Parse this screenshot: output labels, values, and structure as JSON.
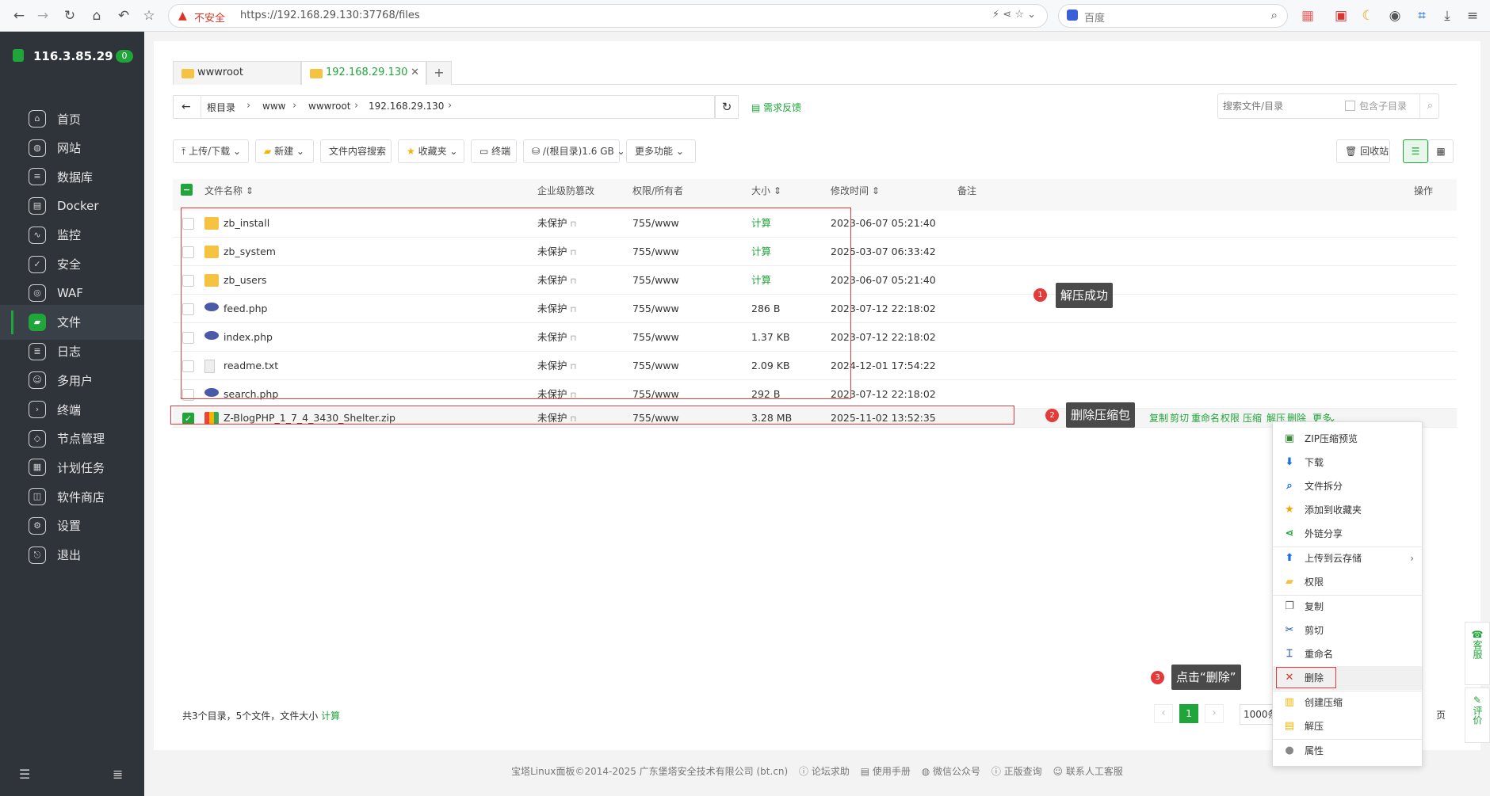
{
  "browser": {
    "url_warning": "不安全",
    "url": "https://192.168.29.130:37768/files",
    "search_engine": "百度"
  },
  "sidebar": {
    "server_ip": "116.3.85.29",
    "badge": "0",
    "items": [
      {
        "label": "首页",
        "icon": "home-icon"
      },
      {
        "label": "网站",
        "icon": "globe-icon"
      },
      {
        "label": "数据库",
        "icon": "database-icon"
      },
      {
        "label": "Docker",
        "icon": "docker-icon"
      },
      {
        "label": "监控",
        "icon": "monitor-icon"
      },
      {
        "label": "安全",
        "icon": "shield-icon"
      },
      {
        "label": "WAF",
        "icon": "waf-icon"
      },
      {
        "label": "文件",
        "icon": "folder-icon",
        "active": true
      },
      {
        "label": "日志",
        "icon": "log-icon"
      },
      {
        "label": "多用户",
        "icon": "users-icon"
      },
      {
        "label": "终端",
        "icon": "terminal-icon"
      },
      {
        "label": "节点管理",
        "icon": "node-icon"
      },
      {
        "label": "计划任务",
        "icon": "calendar-icon"
      },
      {
        "label": "软件商店",
        "icon": "store-icon"
      },
      {
        "label": "设置",
        "icon": "settings-icon"
      },
      {
        "label": "退出",
        "icon": "logout-icon"
      }
    ]
  },
  "tabs": [
    {
      "label": "wwwroot"
    },
    {
      "label": "192.168.29.130",
      "active": true
    }
  ],
  "breadcrumb": [
    "根目录",
    "www",
    "wwwroot",
    "192.168.29.130"
  ],
  "feedback": "需求反馈",
  "search": {
    "placeholder": "搜索文件/目录",
    "subdir_label": "包含子目录"
  },
  "toolbar": {
    "upload": "上传/下载",
    "new": "新建",
    "content_search": "文件内容搜索",
    "favorites": "收藏夹",
    "terminal": "终端",
    "disk": "/(根目录)1.6 GB",
    "more": "更多功能",
    "recycle": "回收站"
  },
  "columns": {
    "name": "文件名称",
    "protect": "企业级防篡改",
    "perm": "权限/所有者",
    "size": "大小",
    "mtime": "修改时间",
    "note": "备注",
    "ops": "操作"
  },
  "files": [
    {
      "name": "zb_install",
      "type": "folder",
      "protect": "未保护",
      "perm": "755/www",
      "size": "计算",
      "mtime": "2023-06-07 05:21:40"
    },
    {
      "name": "zb_system",
      "type": "folder",
      "protect": "未保护",
      "perm": "755/www",
      "size": "计算",
      "mtime": "2025-03-07 06:33:42"
    },
    {
      "name": "zb_users",
      "type": "folder",
      "protect": "未保护",
      "perm": "755/www",
      "size": "计算",
      "mtime": "2023-06-07 05:21:40"
    },
    {
      "name": "feed.php",
      "type": "php",
      "protect": "未保护",
      "perm": "755/www",
      "size": "286 B",
      "mtime": "2023-07-12 22:18:02"
    },
    {
      "name": "index.php",
      "type": "php",
      "protect": "未保护",
      "perm": "755/www",
      "size": "1.37 KB",
      "mtime": "2023-07-12 22:18:02"
    },
    {
      "name": "readme.txt",
      "type": "txt",
      "protect": "未保护",
      "perm": "755/www",
      "size": "2.09 KB",
      "mtime": "2024-12-01 17:54:22"
    },
    {
      "name": "search.php",
      "type": "php",
      "protect": "未保护",
      "perm": "755/www",
      "size": "292 B",
      "mtime": "2023-07-12 22:18:02"
    },
    {
      "name": "Z-BlogPHP_1_7_4_3430_Shelter.zip",
      "type": "zip",
      "protect": "未保护",
      "perm": "755/www",
      "size": "3.28 MB",
      "mtime": "2025-11-02 13:52:35",
      "selected": true
    }
  ],
  "row_actions": [
    "复制",
    "剪切",
    "重命名",
    "权限",
    "压缩",
    "解压",
    "删除",
    "更多"
  ],
  "annotations": [
    {
      "num": "1",
      "text": "解压成功"
    },
    {
      "num": "2",
      "text": "删除压缩包"
    },
    {
      "num": "3",
      "text": "点击“删除”"
    }
  ],
  "context_menu": [
    {
      "label": "ZIP压缩预览",
      "icon": "zip-preview-icon"
    },
    {
      "label": "下载",
      "icon": "download-icon"
    },
    {
      "label": "文件拆分",
      "icon": "split-icon"
    },
    {
      "label": "添加到收藏夹",
      "icon": "star-icon"
    },
    {
      "label": "外链分享",
      "icon": "share-icon"
    },
    {
      "label": "上传到云存储",
      "icon": "upload-cloud-icon",
      "submenu": true
    },
    {
      "label": "权限",
      "icon": "permission-icon"
    },
    {
      "label": "复制",
      "icon": "copy-icon"
    },
    {
      "label": "剪切",
      "icon": "cut-icon"
    },
    {
      "label": "重命名",
      "icon": "rename-icon"
    },
    {
      "label": "删除",
      "icon": "delete-icon",
      "highlight": true
    },
    {
      "label": "创建压缩",
      "icon": "compress-icon"
    },
    {
      "label": "解压",
      "icon": "extract-icon"
    },
    {
      "label": "属性",
      "icon": "info-icon"
    }
  ],
  "summary": {
    "text": "共3个目录，5个文件，文件大小",
    "calc": "计算"
  },
  "pagination": {
    "current": "1",
    "page_size": "1000条",
    "suffix": "页"
  },
  "side_float": {
    "service": "客服",
    "review": "评价"
  },
  "footer": {
    "copyright": "宝塔Linux面板©2014-2025 广东堡塔安全技术有限公司 (bt.cn)",
    "links": [
      "论坛求助",
      "使用手册",
      "微信公众号",
      "正版查询",
      "联系人工客服"
    ]
  }
}
